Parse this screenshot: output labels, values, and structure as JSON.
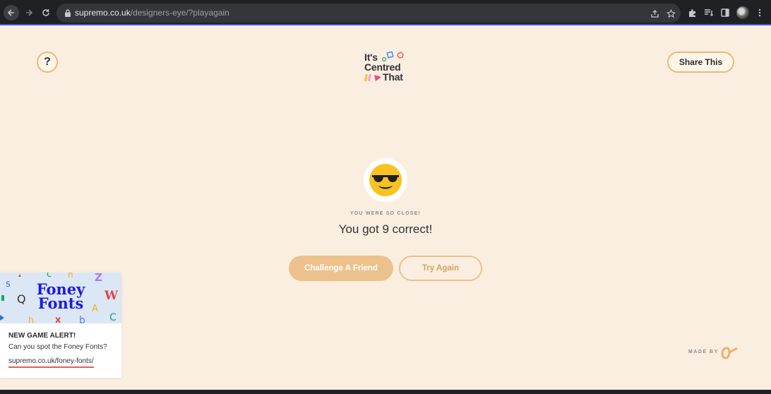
{
  "browser": {
    "url_domain": "supremo.co.uk",
    "url_path": "/designers-eye/?playagain"
  },
  "header": {
    "help_label": "?",
    "share_label": "Share This",
    "logo": {
      "line1": "It's",
      "line2": "Centred",
      "line3": "That"
    }
  },
  "result": {
    "emoji": "sunglasses-face",
    "subtitle": "YOU WERE SO CLOSE!",
    "score_text": "You got 9 correct!",
    "challenge_label": "Challenge A Friend",
    "try_again_label": "Try Again"
  },
  "promo": {
    "banner_line1": "Foney",
    "banner_line2": "Fonts",
    "banner_letters": [
      "s",
      "c",
      "n",
      "Z",
      "Q",
      "W",
      "A",
      "h",
      "x",
      "b",
      "C"
    ],
    "alert": "NEW GAME ALERT!",
    "description": "Can you spot the Foney Fonts?",
    "link": "supremo.co.uk/foney-fonts/"
  },
  "footer": {
    "made_by": "MADE BY"
  },
  "colors": {
    "background": "#faeee0",
    "accent": "#edc18b",
    "accent_text": "#d9a15c",
    "promo_blue": "#1b1be0"
  }
}
